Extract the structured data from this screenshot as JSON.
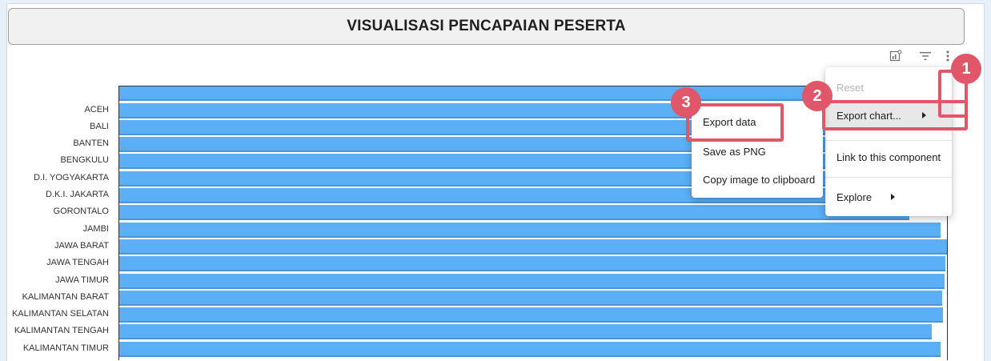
{
  "title": "VISUALISASI PENCAPAIAN PESERTA",
  "toolbar": {
    "icons": [
      "chart-explore-icon",
      "filter-icon",
      "more-vert-icon"
    ]
  },
  "chart_data": {
    "type": "bar",
    "orientation": "horizontal",
    "categories": [
      "ACEH",
      "BALI",
      "BANTEN",
      "BENGKULU",
      "D.I. YOGYAKARTA",
      "D.K.I. JAKARTA",
      "GORONTALO",
      "JAMBI",
      "JAWA BARAT",
      "JAWA TENGAH",
      "JAWA TIMUR",
      "KALIMANTAN BARAT",
      "KALIMANTAN SELATAN",
      "KALIMANTAN TENGAH",
      "KALIMANTAN TIMUR"
    ],
    "values": [
      1.0,
      1.0,
      1.0,
      1.0,
      1.0,
      1.0,
      0.955,
      0.992,
      1.0,
      0.998,
      0.997,
      0.994,
      0.995,
      0.982,
      0.992
    ],
    "top_partial_value": 1.0,
    "color": "#5aaff5"
  },
  "menu_main": {
    "items": [
      "Reset",
      "Export chart...",
      "Link to this component",
      "Explore"
    ]
  },
  "menu_export": {
    "items": [
      "Export data",
      "Save as PNG",
      "Copy image to clipboard"
    ]
  },
  "badges": [
    "1",
    "2",
    "3"
  ],
  "highlight_color": "#e0576a"
}
